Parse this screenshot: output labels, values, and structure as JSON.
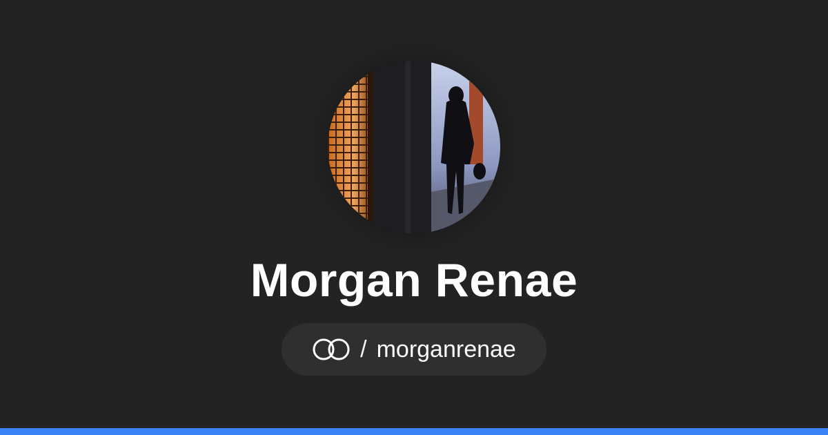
{
  "profile": {
    "name": "Morgan Renae",
    "avatar_icon": "profile-photo",
    "handle": "morganrenae",
    "separator": "/",
    "logo_icon": "linked-rings-icon"
  },
  "colors": {
    "background": "#232323",
    "pill": "#2f2f2f",
    "text": "#ffffff",
    "accent_bar": "#3b82f6"
  }
}
